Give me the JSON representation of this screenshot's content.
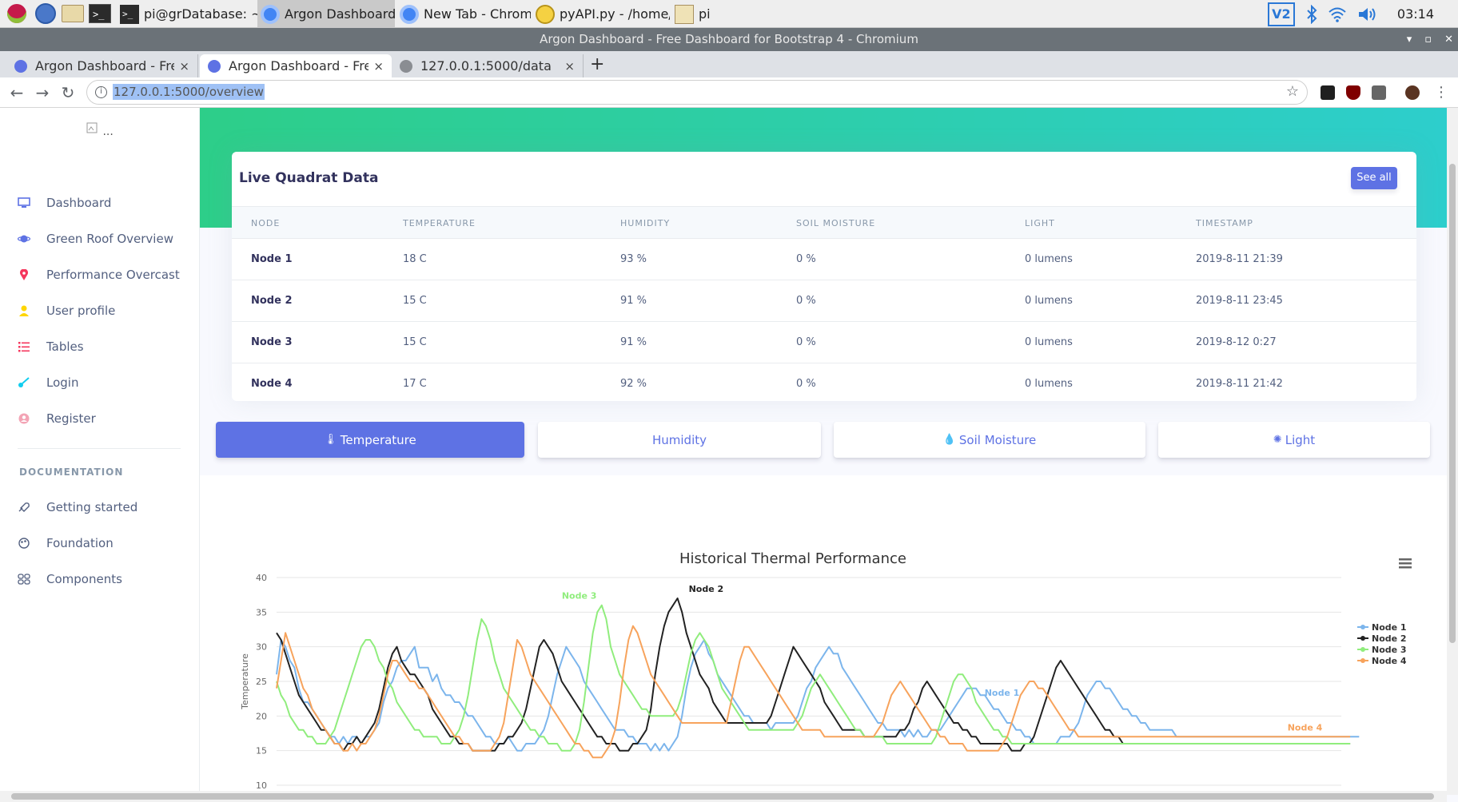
{
  "taskbar": {
    "tasks": [
      {
        "label": "pi@grDatabase: ~",
        "icon": "terminal-icon"
      },
      {
        "label": "Argon Dashboard - Fr...",
        "icon": "chromium-icon"
      },
      {
        "label": "New Tab - Chromium",
        "icon": "chromium-icon"
      },
      {
        "label": "pyAPI.py - /home/pi/...",
        "icon": "python-editor-icon"
      },
      {
        "label": "pi",
        "icon": "folder-icon"
      }
    ],
    "tray": {
      "vnc_label": "V2",
      "clock": "03:14"
    }
  },
  "window": {
    "title": "Argon Dashboard - Free Dashboard for Bootstrap 4 - Chromium"
  },
  "tabs": [
    {
      "title": "Argon Dashboard - Free D",
      "close": "×"
    },
    {
      "title": "Argon Dashboard - Free D",
      "close": "×"
    },
    {
      "title": "127.0.0.1:5000/data",
      "close": "×"
    }
  ],
  "toolbar": {
    "url": "127.0.0.1:5000/overview",
    "new_tab": "+"
  },
  "sidebar": {
    "logo_alt": "...",
    "items": [
      {
        "label": "Dashboard",
        "icon": "tv-icon",
        "color": "#5e72e4"
      },
      {
        "label": "Green Roof Overview",
        "icon": "planet-icon",
        "color": "#5e72e4"
      },
      {
        "label": "Performance Overcast",
        "icon": "pin-icon",
        "color": "#f5365c"
      },
      {
        "label": "User profile",
        "icon": "user-icon",
        "color": "#ffd600"
      },
      {
        "label": "Tables",
        "icon": "bullet-list-icon",
        "color": "#f5365c"
      },
      {
        "label": "Login",
        "icon": "key-icon",
        "color": "#11cdef"
      },
      {
        "label": "Register",
        "icon": "circle-user-icon",
        "color": "#f3a4b5"
      }
    ],
    "doc_heading": "DOCUMENTATION",
    "doc_items": [
      {
        "label": "Getting started",
        "icon": "spaceship-icon"
      },
      {
        "label": "Foundation",
        "icon": "palette-icon"
      },
      {
        "label": "Components",
        "icon": "ui-04-icon"
      }
    ]
  },
  "card": {
    "title": "Live Quadrat Data",
    "see_all": "See all",
    "columns": [
      "NODE",
      "TEMPERATURE",
      "HUMIDITY",
      "SOIL MOISTURE",
      "LIGHT",
      "TIMESTAMP"
    ],
    "rows": [
      [
        "Node 1",
        "18 C",
        "93 %",
        "0 %",
        "0 lumens",
        "2019-8-11 21:39"
      ],
      [
        "Node 2",
        "15 C",
        "91 %",
        "0 %",
        "0 lumens",
        "2019-8-11 23:45"
      ],
      [
        "Node 3",
        "15 C",
        "91 %",
        "0 %",
        "0 lumens",
        "2019-8-12 0:27"
      ],
      [
        "Node 4",
        "17 C",
        "92 %",
        "0 %",
        "0 lumens",
        "2019-8-11 21:42"
      ]
    ]
  },
  "pills": [
    {
      "label": "Temperature",
      "icon": "thermometer-icon",
      "glyph": "🌡",
      "active": true
    },
    {
      "label": "Humidity",
      "icon": "",
      "glyph": "",
      "active": false
    },
    {
      "label": "Soil Moisture",
      "icon": "drop-icon",
      "glyph": "💧",
      "active": false
    },
    {
      "label": "Light",
      "icon": "sun-icon",
      "glyph": "✺",
      "active": false
    }
  ],
  "chart_data": {
    "type": "line",
    "title": "Historical Thermal Performance",
    "ylabel": "Temperature",
    "xlabel": "",
    "ylim": [
      10,
      40
    ],
    "yticks": [
      10,
      15,
      20,
      25,
      30,
      35,
      40
    ],
    "grid": true,
    "legend": "right",
    "menu_icon": "hamburger-menu-icon",
    "n_points": 240,
    "series": [
      {
        "name": "Node 1",
        "color": "#7cb5ec",
        "values": [
          26,
          31,
          30,
          28,
          27,
          24,
          22,
          22,
          21,
          20,
          19,
          18,
          17,
          17,
          16,
          17,
          16,
          17,
          17,
          16,
          17,
          17,
          18,
          19,
          22,
          24,
          25,
          27,
          28,
          28,
          29,
          30,
          27,
          27,
          27,
          25,
          26,
          24,
          23,
          23,
          22,
          22,
          21,
          20,
          20,
          19,
          18,
          17,
          17,
          16,
          16,
          16,
          17,
          16,
          15,
          15,
          16,
          16,
          16,
          17,
          18,
          20,
          23,
          26,
          28,
          30,
          29,
          28,
          27,
          25,
          24,
          23,
          22,
          21,
          20,
          19,
          18,
          18,
          18,
          17,
          17,
          16,
          16,
          16,
          15,
          16,
          15,
          16,
          15,
          16,
          17,
          20,
          24,
          27,
          29,
          30,
          31,
          29,
          28,
          26,
          25,
          24,
          23,
          22,
          21,
          20,
          20,
          19,
          19,
          19,
          19,
          18,
          19,
          19,
          19,
          19,
          19,
          20,
          22,
          24,
          25,
          27,
          28,
          29,
          30,
          29,
          29,
          27,
          26,
          25,
          24,
          23,
          22,
          21,
          20,
          19,
          19,
          18,
          18,
          18,
          18,
          17,
          18,
          17,
          18,
          17,
          17,
          18,
          18,
          18,
          19,
          20,
          21,
          22,
          23,
          24,
          24,
          24,
          23,
          23,
          22,
          21,
          21,
          20,
          19,
          19,
          18,
          18,
          17,
          17,
          16,
          16,
          16,
          16,
          16,
          16,
          17,
          17,
          17,
          18,
          19,
          21,
          23,
          24,
          25,
          25,
          24,
          24,
          23,
          22,
          21,
          21,
          20,
          20,
          19,
          19,
          18,
          18,
          18,
          18,
          18,
          18,
          17,
          17,
          17,
          17,
          17,
          17,
          17,
          17,
          17,
          17,
          17,
          17,
          17,
          17,
          17,
          17,
          17,
          17,
          17,
          17,
          17,
          17,
          17,
          17,
          17,
          17,
          17,
          17,
          17,
          17,
          17,
          17,
          17,
          17,
          17,
          17,
          17,
          17,
          17,
          17,
          17,
          17
        ]
      },
      {
        "name": "Node 2",
        "color": "#222222",
        "values": [
          32,
          31,
          29,
          27,
          25,
          23,
          22,
          21,
          20,
          19,
          18,
          18,
          17,
          16,
          16,
          15,
          16,
          16,
          17,
          16,
          17,
          18,
          19,
          21,
          24,
          27,
          29,
          30,
          28,
          27,
          26,
          26,
          25,
          24,
          23,
          21,
          20,
          19,
          18,
          17,
          17,
          16,
          16,
          16,
          15,
          15,
          15,
          15,
          15,
          15,
          16,
          16,
          17,
          17,
          18,
          19,
          21,
          24,
          27,
          30,
          31,
          30,
          29,
          27,
          25,
          24,
          23,
          22,
          21,
          20,
          19,
          18,
          17,
          17,
          16,
          16,
          16,
          15,
          15,
          15,
          16,
          16,
          17,
          18,
          21,
          26,
          30,
          33,
          35,
          36,
          37,
          35,
          32,
          30,
          28,
          26,
          25,
          24,
          22,
          21,
          20,
          19,
          19,
          19,
          19,
          19,
          19,
          19,
          19,
          19,
          19,
          20,
          22,
          24,
          26,
          28,
          30,
          29,
          28,
          27,
          26,
          25,
          24,
          22,
          21,
          20,
          19,
          18,
          18,
          18,
          18,
          18,
          17,
          17,
          17,
          17,
          17,
          17,
          17,
          17,
          18,
          18,
          19,
          21,
          22,
          24,
          25,
          24,
          23,
          22,
          21,
          20,
          19,
          19,
          18,
          18,
          17,
          17,
          16,
          16,
          16,
          16,
          16,
          16,
          16,
          15,
          15,
          15,
          16,
          16,
          17,
          19,
          21,
          23,
          25,
          27,
          28,
          27,
          26,
          25,
          24,
          23,
          22,
          21,
          20,
          19,
          18,
          18,
          17,
          17,
          16,
          16,
          16,
          16,
          16,
          16,
          16,
          16,
          16,
          16,
          16,
          16,
          16,
          16,
          16,
          16,
          16,
          16,
          16,
          16,
          16,
          16,
          16,
          16,
          16,
          16,
          16,
          16,
          16,
          16,
          16,
          16,
          16,
          16,
          16,
          16,
          16,
          16,
          16,
          16,
          16,
          16,
          16,
          16,
          16,
          16,
          16,
          16,
          16,
          16,
          16,
          16
        ]
      },
      {
        "name": "Node 3",
        "color": "#90ed7d",
        "values": [
          25,
          23,
          22,
          20,
          19,
          18,
          18,
          17,
          17,
          16,
          16,
          16,
          17,
          18,
          20,
          22,
          24,
          26,
          28,
          30,
          31,
          31,
          30,
          28,
          27,
          25,
          24,
          22,
          21,
          20,
          19,
          18,
          18,
          17,
          17,
          17,
          17,
          16,
          16,
          16,
          17,
          18,
          20,
          23,
          27,
          31,
          34,
          33,
          31,
          28,
          26,
          24,
          23,
          22,
          21,
          20,
          19,
          18,
          18,
          17,
          17,
          16,
          16,
          16,
          15,
          15,
          15,
          16,
          18,
          22,
          27,
          32,
          35,
          36,
          34,
          30,
          28,
          26,
          25,
          24,
          23,
          22,
          21,
          21,
          20,
          20,
          20,
          20,
          20,
          20,
          21,
          23,
          26,
          29,
          31,
          32,
          31,
          30,
          28,
          26,
          24,
          23,
          22,
          21,
          20,
          19,
          18,
          18,
          18,
          18,
          18,
          18,
          18,
          18,
          18,
          18,
          18,
          19,
          20,
          22,
          24,
          25,
          26,
          25,
          24,
          23,
          22,
          21,
          20,
          19,
          18,
          18,
          17,
          17,
          17,
          17,
          17,
          16,
          16,
          16,
          16,
          16,
          16,
          16,
          16,
          16,
          16,
          16,
          17,
          19,
          21,
          23,
          25,
          26,
          26,
          25,
          24,
          22,
          21,
          20,
          19,
          18,
          18,
          17,
          17,
          16,
          16,
          16,
          16,
          16,
          16,
          16,
          16,
          16,
          16,
          16,
          16,
          16,
          16,
          16,
          16,
          16,
          16,
          16,
          16,
          16,
          16,
          16,
          16,
          16,
          16,
          16,
          16,
          16,
          16,
          16,
          16,
          16,
          16,
          16,
          16,
          16,
          16,
          16,
          16,
          16,
          16,
          16,
          16,
          16,
          16,
          16,
          16,
          16,
          16,
          16,
          16,
          16,
          16,
          16,
          16,
          16,
          16,
          16,
          16,
          16,
          16,
          16,
          16,
          16,
          16,
          16,
          16,
          16,
          16,
          16,
          16,
          16,
          16,
          16,
          16,
          16
        ]
      },
      {
        "name": "Node 4",
        "color": "#f7a35c",
        "values": [
          24,
          28,
          32,
          30,
          28,
          26,
          24,
          23,
          21,
          20,
          19,
          18,
          17,
          16,
          16,
          15,
          15,
          16,
          15,
          16,
          16,
          17,
          18,
          20,
          23,
          26,
          28,
          28,
          27,
          26,
          25,
          25,
          24,
          24,
          23,
          22,
          21,
          20,
          19,
          18,
          17,
          17,
          16,
          16,
          15,
          15,
          15,
          15,
          15,
          16,
          17,
          19,
          23,
          27,
          31,
          30,
          28,
          26,
          25,
          24,
          23,
          22,
          21,
          20,
          19,
          18,
          17,
          16,
          16,
          15,
          15,
          14,
          14,
          14,
          15,
          16,
          18,
          22,
          27,
          31,
          33,
          32,
          30,
          28,
          26,
          25,
          24,
          23,
          22,
          21,
          20,
          19,
          19,
          19,
          19,
          19,
          19,
          19,
          19,
          19,
          19,
          19,
          22,
          25,
          28,
          30,
          30,
          29,
          28,
          27,
          26,
          25,
          24,
          23,
          22,
          21,
          20,
          19,
          18,
          18,
          18,
          18,
          18,
          17,
          17,
          17,
          17,
          17,
          17,
          17,
          17,
          17,
          17,
          17,
          17,
          18,
          19,
          21,
          23,
          24,
          25,
          24,
          23,
          22,
          21,
          20,
          19,
          18,
          18,
          17,
          17,
          16,
          16,
          16,
          16,
          15,
          15,
          15,
          15,
          15,
          15,
          15,
          15,
          16,
          17,
          19,
          21,
          23,
          24,
          25,
          25,
          24,
          24,
          23,
          22,
          21,
          20,
          19,
          18,
          18,
          17,
          17,
          17,
          17,
          17,
          17,
          17,
          17,
          17,
          17,
          17,
          17,
          17,
          17,
          17,
          17,
          17,
          17,
          17,
          17,
          17,
          17,
          17,
          17,
          17,
          17,
          17,
          17,
          17,
          17,
          17,
          17,
          17,
          17,
          17,
          17,
          17,
          17,
          17,
          17,
          17,
          17,
          17,
          17,
          17,
          17,
          17,
          17,
          17,
          17,
          17,
          17,
          17,
          17,
          17,
          17,
          17,
          17,
          17,
          17,
          17,
          17
        ]
      }
    ],
    "annotations": [
      {
        "text": "Node 3",
        "series": "Node 3"
      },
      {
        "text": "Node 2",
        "series": "Node 2"
      },
      {
        "text": "Node 1",
        "series": "Node 1"
      },
      {
        "text": "Node 4",
        "series": "Node 4"
      }
    ]
  }
}
